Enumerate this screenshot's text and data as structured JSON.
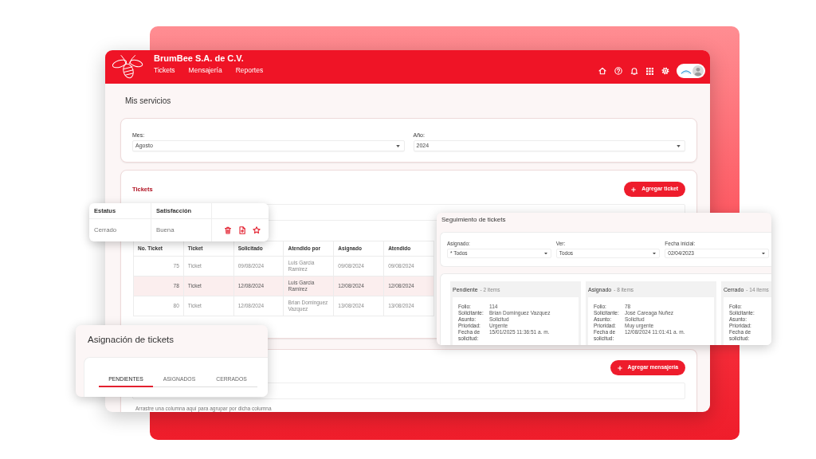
{
  "app": {
    "title": "BrumBee S.A. de C.V.",
    "nav": [
      {
        "label": "Tickets",
        "selected": false
      },
      {
        "label": "Mensajería",
        "selected": false
      },
      {
        "label": "Reportes",
        "selected": false
      }
    ]
  },
  "page_title": "Mis servicios",
  "filters": [
    {
      "label": "Mes:",
      "value": "Agosto"
    },
    {
      "label": "Año:",
      "value": "2024"
    }
  ],
  "tickets": {
    "title": "Tickets",
    "add_button": "Agregar ticket",
    "columns": [
      "No. Ticket",
      "Ticket",
      "Solicitado",
      "Atendido por",
      "Asignado",
      "Atendido"
    ],
    "rows": [
      {
        "selected": false,
        "cells": [
          "75",
          "Ticket",
          "09/08/2024",
          "Luis Garcia Ramirez",
          "09/08/2024",
          "09/08/2024"
        ]
      },
      {
        "selected": true,
        "cells": [
          "78",
          "Ticket",
          "12/08/2024",
          "Luis Garcia Ramirez",
          "12/08/2024",
          "12/08/2024"
        ]
      },
      {
        "selected": false,
        "cells": [
          "80",
          "Ticket",
          "12/08/2024",
          "Brian Dominguez Vazquez",
          "13/08/2024",
          "13/08/2024"
        ]
      }
    ]
  },
  "messaging": {
    "add_button": "Agregar mensajería",
    "hint": "Arrastre una columna aquí para agrupar por dicha columna"
  },
  "status_card": {
    "columns": [
      "Estatus",
      "Satisfacción"
    ],
    "cells": [
      "Cerrado",
      "Buena"
    ]
  },
  "tracking": {
    "title": "Seguimiento de tickets",
    "filters": [
      {
        "label": "Asignado:",
        "value": "* Todos"
      },
      {
        "label": "Ver:",
        "value": "Todos"
      },
      {
        "label": "Fecha inicial:",
        "value": "02/04/2023"
      }
    ],
    "lanes": [
      {
        "name": "Pendiente",
        "count": "- 2 items",
        "fields": [
          {
            "label": "Folio:",
            "value": "114"
          },
          {
            "label": "Solicitante:",
            "value": "Brian Dominguez Vazquez"
          },
          {
            "label": "Asunto:",
            "value": "Solicitud"
          },
          {
            "label": "Prioridad:",
            "value": "Urgente"
          },
          {
            "label": "Fecha de solicitud:",
            "value": "15/01/2025 11:36:51 a. m."
          }
        ]
      },
      {
        "name": "Asignado",
        "count": "- 8 items",
        "fields": [
          {
            "label": "Folio:",
            "value": "78"
          },
          {
            "label": "Solicitante:",
            "value": "José Careaga Nuñez"
          },
          {
            "label": "Asunto:",
            "value": "Solicitud"
          },
          {
            "label": "Prioridad:",
            "value": "Muy urgente"
          },
          {
            "label": "Fecha de solicitud:",
            "value": "12/08/2024 11:01:41 a. m."
          }
        ]
      },
      {
        "name": "Cerrado",
        "count": "- 14 items",
        "fields": [
          {
            "label": "Folio:"
          },
          {
            "label": "Solicitante:"
          },
          {
            "label": "Asunto:"
          },
          {
            "label": "Prioridad:"
          },
          {
            "label": "Fecha de solicitud:"
          }
        ]
      }
    ]
  },
  "assignment": {
    "title": "Asignación de tickets",
    "tabs": [
      {
        "label": "PENDIENTES",
        "selected": true
      },
      {
        "label": "ASIGNADOS",
        "selected": false
      },
      {
        "label": "CERRADOS",
        "selected": false
      }
    ]
  }
}
